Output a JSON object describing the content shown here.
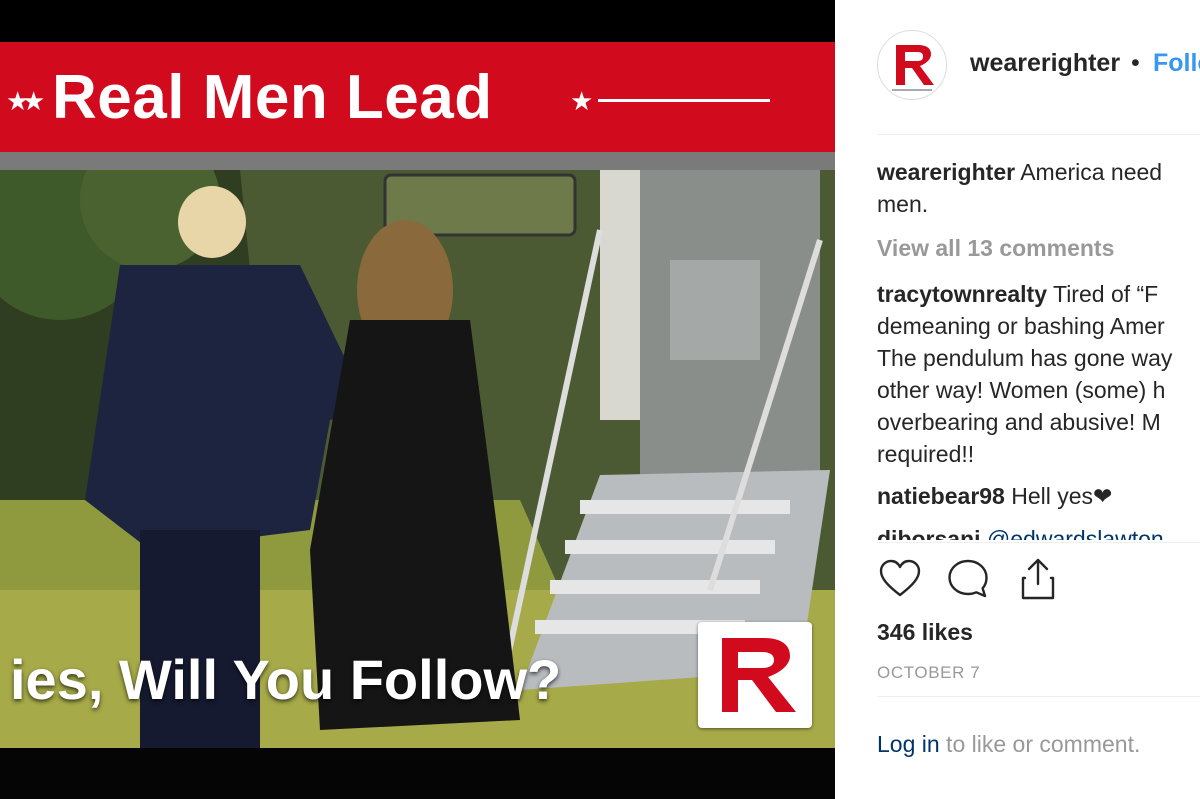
{
  "post_image": {
    "banner_title": "Real Men Lead",
    "caption": "ies, Will You Follow?",
    "logo_letter": "R",
    "colors": {
      "banner_red": "#d20a1e",
      "logo_red": "#d20a1e"
    }
  },
  "header": {
    "username": "wearerighter",
    "separator": "•",
    "follow_label": "Follo",
    "avatar_letter": "R"
  },
  "caption": {
    "username": "wearerighter",
    "text_line1": "America need",
    "text_line2": "men."
  },
  "view_all_comments": "View all 13 comments",
  "comments": [
    {
      "username": "tracytownrealty",
      "lines": [
        "Tired of “F",
        "demeaning or bashing Amer",
        "The pendulum has gone way",
        "other way! Women (some) h",
        "overbearing and abusive! M",
        "required!!"
      ]
    },
    {
      "username": "natiebear98",
      "text": "Hell yes❤"
    },
    {
      "username": "diborsani",
      "text": "@edwardslawton"
    }
  ],
  "actions": {
    "like_icon": "heart-icon",
    "comment_icon": "comment-bubble-icon",
    "share_icon": "share-icon"
  },
  "likes": "346 likes",
  "date": "OCTOBER 7",
  "login": {
    "link": "Log in",
    "rest": " to like or comment."
  },
  "colors": {
    "link_blue": "#3897f0",
    "link_dark": "#003569",
    "muted": "#999999",
    "text": "#262626"
  }
}
